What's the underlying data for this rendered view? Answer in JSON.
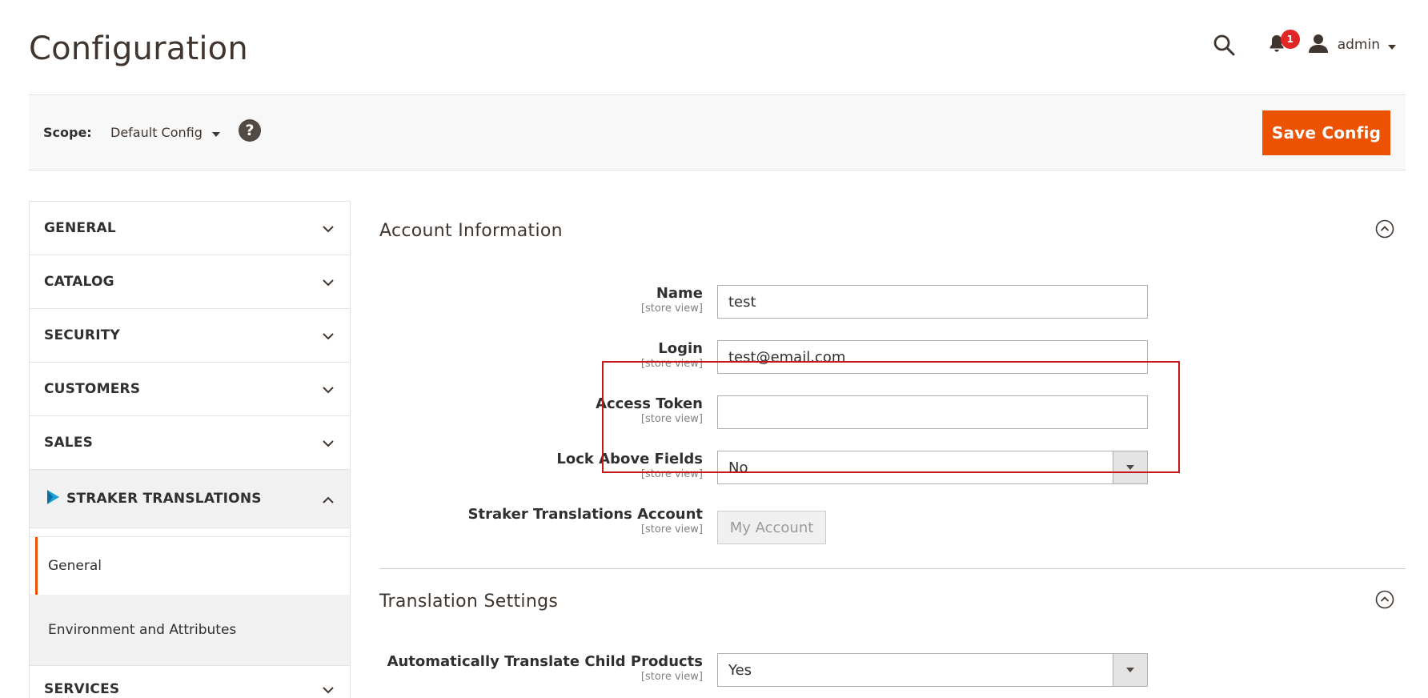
{
  "header": {
    "title": "Configuration",
    "notification_count": "1",
    "user_name": "admin"
  },
  "scope_bar": {
    "label": "Scope:",
    "value": "Default Config",
    "help": "?",
    "save_label": "Save Config"
  },
  "sidebar": {
    "tabs": [
      {
        "label": "GENERAL",
        "expanded": false
      },
      {
        "label": "CATALOG",
        "expanded": false
      },
      {
        "label": "SECURITY",
        "expanded": false
      },
      {
        "label": "CUSTOMERS",
        "expanded": false
      },
      {
        "label": "SALES",
        "expanded": false
      },
      {
        "label": "STRAKER TRANSLATIONS",
        "expanded": true
      },
      {
        "label": "SERVICES",
        "expanded": false
      }
    ],
    "sub_items": [
      {
        "label": "General",
        "active": true
      },
      {
        "label": "Environment and Attributes",
        "active": false
      }
    ]
  },
  "account_section": {
    "title": "Account Information",
    "fields": [
      {
        "label": "Name",
        "scope": "[store view]",
        "value": "test"
      },
      {
        "label": "Login",
        "scope": "[store view]",
        "value": "test@email.com"
      },
      {
        "label": "Access Token",
        "scope": "[store view]",
        "value": ""
      },
      {
        "label": "Lock Above Fields",
        "scope": "[store view]",
        "value": "No"
      },
      {
        "label": "Straker Translations Account",
        "scope": "[store view]",
        "button": "My Account"
      }
    ]
  },
  "translation_section": {
    "title": "Translation Settings",
    "fields": [
      {
        "label": "Automatically Translate Child Products",
        "scope": "[store view]",
        "value": "Yes"
      }
    ]
  },
  "colors": {
    "accent": "#eb5202",
    "badge": "#e22626",
    "highlight": "#c8161d",
    "straker_logo": "#1da1d6"
  },
  "icons": [
    "search-icon",
    "bell-icon",
    "user-icon",
    "caret-down-icon",
    "help-icon",
    "chevron-down-icon",
    "chevron-up-icon",
    "straker-logo-icon",
    "collapse-circle-icon"
  ]
}
